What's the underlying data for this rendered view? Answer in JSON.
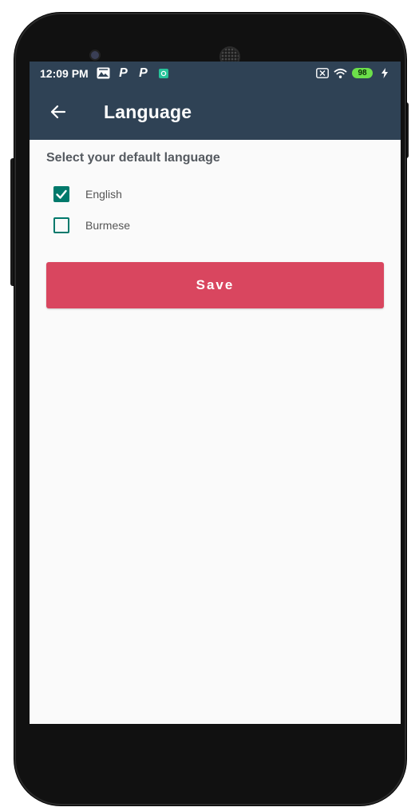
{
  "status_bar": {
    "time": "12:09 PM",
    "left_icons": [
      "photos-icon",
      "p-app-icon",
      "p-app-icon",
      "notification-icon"
    ],
    "p_letter": "P",
    "battery_level": "98",
    "right_icons": [
      "no-sim-icon",
      "wifi-icon",
      "battery-icon",
      "charging-icon"
    ]
  },
  "app_bar": {
    "title": "Language",
    "back_icon": "back-arrow-icon"
  },
  "main": {
    "section_title": "Select your default language",
    "options": [
      {
        "label": "English",
        "checked": true
      },
      {
        "label": "Burmese",
        "checked": false
      }
    ],
    "save_label": "Save"
  },
  "colors": {
    "app_bar": "#2f4255",
    "accent": "#00796b",
    "save_button": "#d9465f",
    "background": "#fafafa"
  }
}
